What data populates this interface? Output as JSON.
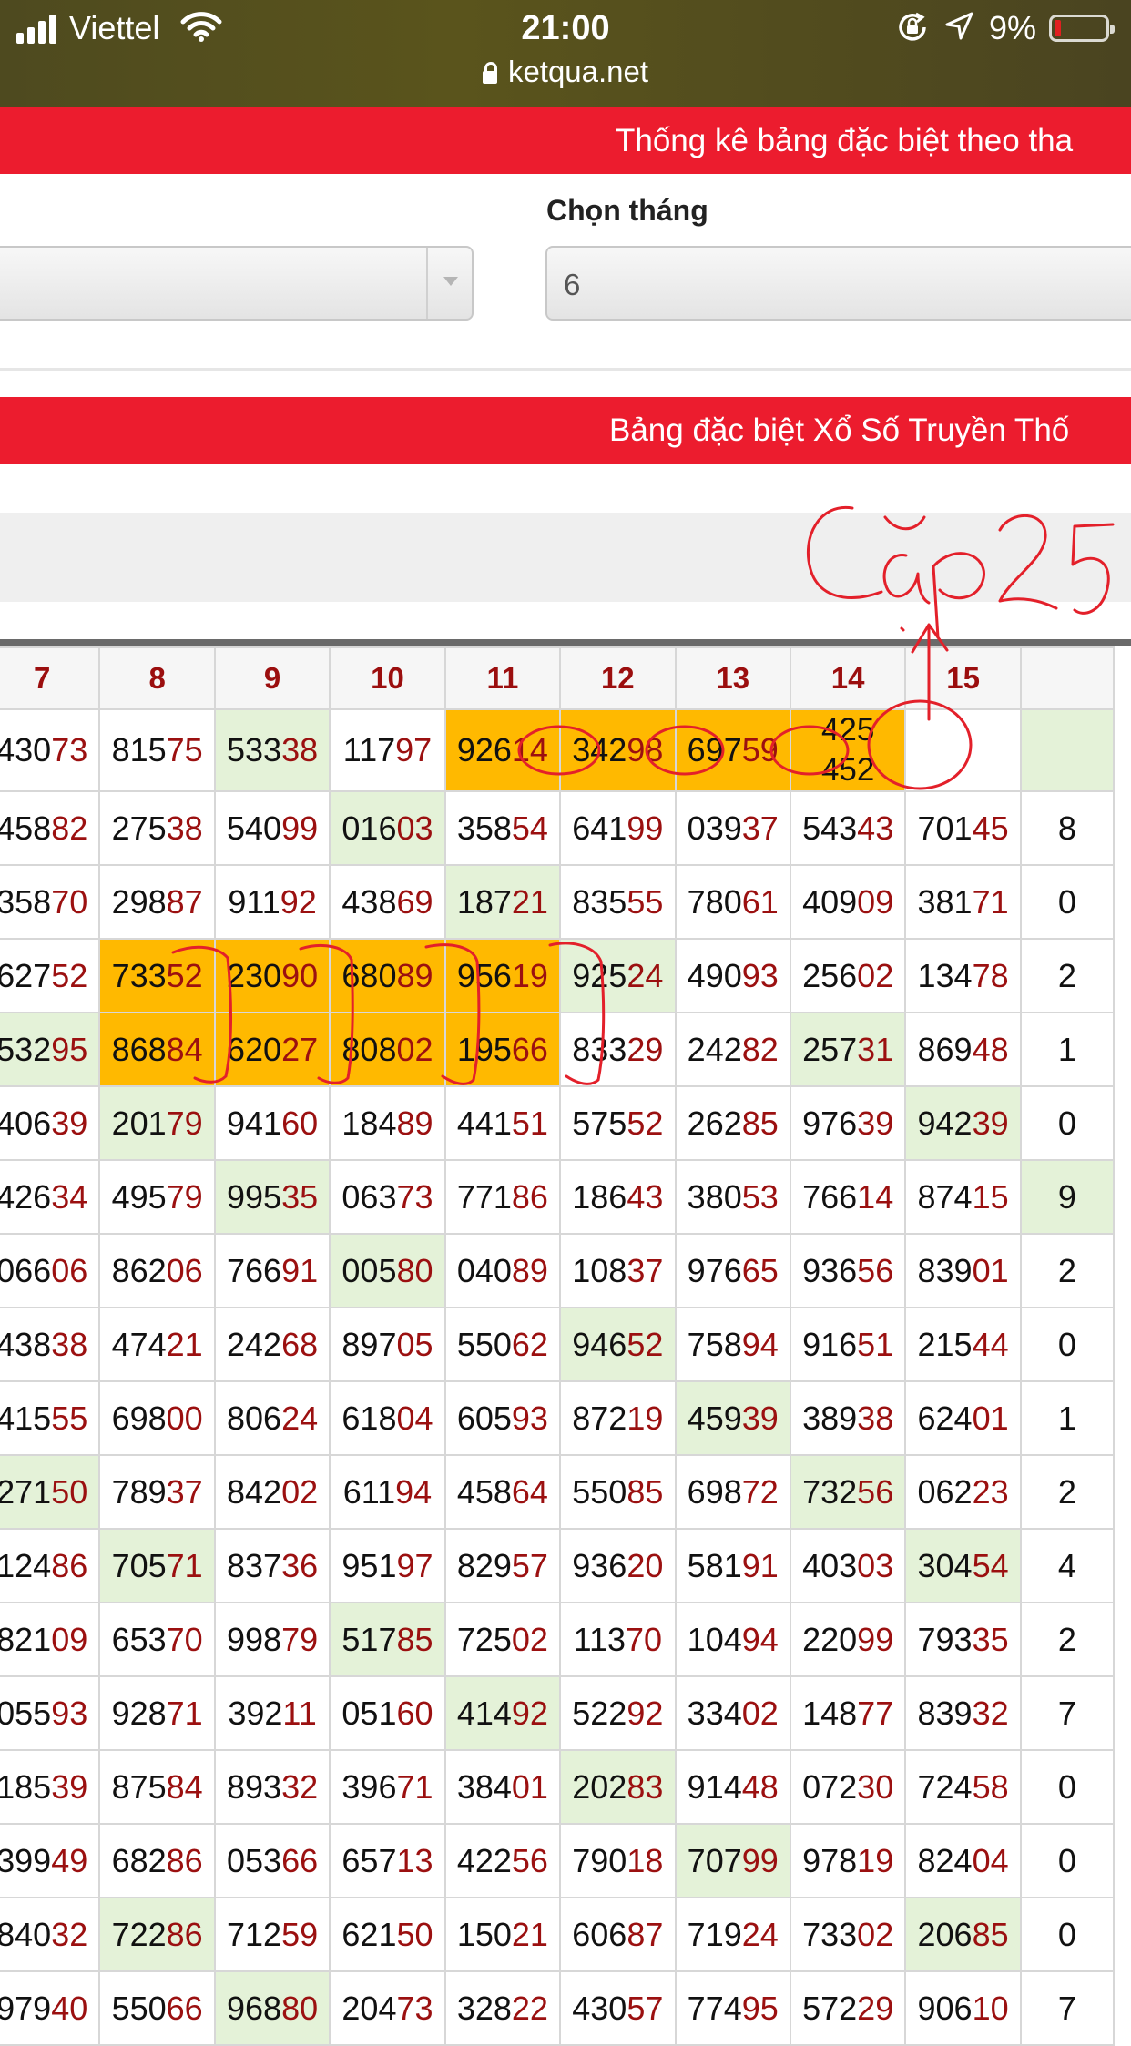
{
  "status_bar": {
    "carrier": "Viettel",
    "time": "21:00",
    "battery_percent": "9%",
    "url": "ketqua.net",
    "battery_level": 0.09
  },
  "banners": {
    "stats_title": "Thống kê bảng đặc biệt theo tha",
    "table_title": "Bảng đặc biệt Xổ Số Truyền Thố"
  },
  "month_select": {
    "label": "Chọn tháng",
    "value": "6"
  },
  "annotation": {
    "text": "Cặp25"
  },
  "colors": {
    "banner": "#ec1c2e",
    "header_text": "#9b0e0e",
    "highlight_orange": "#ffb900",
    "highlight_green": "#e4f2d8",
    "ink": "#e3202a"
  },
  "table": {
    "columns": [
      "7",
      "8",
      "9",
      "10",
      "11",
      "12",
      "13",
      "14",
      "15",
      ""
    ],
    "rows": [
      [
        {
          "t": "43073"
        },
        {
          "t": "81575"
        },
        {
          "t": "53338",
          "g": 1
        },
        {
          "t": "11797"
        },
        {
          "t": "92614",
          "o": 1
        },
        {
          "t": "34298",
          "o": 1
        },
        {
          "t": "69759",
          "o": 1
        },
        {
          "t": "425\n452",
          "o": 1
        },
        {
          "t": ""
        },
        {
          "t": "",
          "g": 1
        }
      ],
      [
        {
          "t": "45882"
        },
        {
          "t": "27538"
        },
        {
          "t": "54099"
        },
        {
          "t": "01603",
          "g": 1
        },
        {
          "t": "35854"
        },
        {
          "t": "64199"
        },
        {
          "t": "03937"
        },
        {
          "t": "54343"
        },
        {
          "t": "70145"
        },
        {
          "t": "8"
        }
      ],
      [
        {
          "t": "35870"
        },
        {
          "t": "29887"
        },
        {
          "t": "91192"
        },
        {
          "t": "43869"
        },
        {
          "t": "18721",
          "g": 1
        },
        {
          "t": "83555"
        },
        {
          "t": "78061"
        },
        {
          "t": "40909"
        },
        {
          "t": "38171"
        },
        {
          "t": "0"
        }
      ],
      [
        {
          "t": "62752"
        },
        {
          "t": "73352",
          "o": 1
        },
        {
          "t": "23090",
          "o": 1
        },
        {
          "t": "68089",
          "o": 1
        },
        {
          "t": "95619",
          "o": 1
        },
        {
          "t": "92524",
          "g": 1
        },
        {
          "t": "49093"
        },
        {
          "t": "25602"
        },
        {
          "t": "13478"
        },
        {
          "t": "2"
        }
      ],
      [
        {
          "t": "53295",
          "g": 1
        },
        {
          "t": "86884",
          "o": 1
        },
        {
          "t": "62027",
          "o": 1
        },
        {
          "t": "80802",
          "o": 1
        },
        {
          "t": "19566",
          "o": 1
        },
        {
          "t": "83329"
        },
        {
          "t": "24282"
        },
        {
          "t": "25731",
          "g": 1
        },
        {
          "t": "86948"
        },
        {
          "t": "1"
        }
      ],
      [
        {
          "t": "40639"
        },
        {
          "t": "20179",
          "g": 1
        },
        {
          "t": "94160"
        },
        {
          "t": "18489"
        },
        {
          "t": "44151"
        },
        {
          "t": "57552"
        },
        {
          "t": "26285"
        },
        {
          "t": "97639"
        },
        {
          "t": "94239",
          "g": 1
        },
        {
          "t": "0"
        }
      ],
      [
        {
          "t": "42634"
        },
        {
          "t": "49579"
        },
        {
          "t": "99535",
          "g": 1
        },
        {
          "t": "06373"
        },
        {
          "t": "77186"
        },
        {
          "t": "18643"
        },
        {
          "t": "38053"
        },
        {
          "t": "76614"
        },
        {
          "t": "87415"
        },
        {
          "t": "9",
          "g": 1
        }
      ],
      [
        {
          "t": "06606"
        },
        {
          "t": "86206"
        },
        {
          "t": "76691"
        },
        {
          "t": "00580",
          "g": 1
        },
        {
          "t": "04089"
        },
        {
          "t": "10837"
        },
        {
          "t": "97665"
        },
        {
          "t": "93656"
        },
        {
          "t": "83901"
        },
        {
          "t": "2"
        }
      ],
      [
        {
          "t": "43838"
        },
        {
          "t": "47421"
        },
        {
          "t": "24268"
        },
        {
          "t": "89705"
        },
        {
          "t": "55062"
        },
        {
          "t": "94652",
          "g": 1
        },
        {
          "t": "75894"
        },
        {
          "t": "91651"
        },
        {
          "t": "21544"
        },
        {
          "t": "0"
        }
      ],
      [
        {
          "t": "41555"
        },
        {
          "t": "69800"
        },
        {
          "t": "80624"
        },
        {
          "t": "61804"
        },
        {
          "t": "60593"
        },
        {
          "t": "87219"
        },
        {
          "t": "45939",
          "g": 1
        },
        {
          "t": "38938"
        },
        {
          "t": "62401"
        },
        {
          "t": "1"
        }
      ],
      [
        {
          "t": "27150",
          "g": 1
        },
        {
          "t": "78937"
        },
        {
          "t": "84202"
        },
        {
          "t": "61194"
        },
        {
          "t": "45864"
        },
        {
          "t": "55085"
        },
        {
          "t": "69872"
        },
        {
          "t": "73256",
          "g": 1
        },
        {
          "t": "06223"
        },
        {
          "t": "2"
        }
      ],
      [
        {
          "t": "12486"
        },
        {
          "t": "70571",
          "g": 1
        },
        {
          "t": "83736"
        },
        {
          "t": "95197"
        },
        {
          "t": "82957"
        },
        {
          "t": "93620"
        },
        {
          "t": "58191"
        },
        {
          "t": "40303"
        },
        {
          "t": "30454",
          "g": 1
        },
        {
          "t": "4"
        }
      ],
      [
        {
          "t": "82109"
        },
        {
          "t": "65370"
        },
        {
          "t": "99879"
        },
        {
          "t": "51785",
          "g": 1
        },
        {
          "t": "72502"
        },
        {
          "t": "11370"
        },
        {
          "t": "10494"
        },
        {
          "t": "22099"
        },
        {
          "t": "79335"
        },
        {
          "t": "2"
        }
      ],
      [
        {
          "t": "05593"
        },
        {
          "t": "92871"
        },
        {
          "t": "39211"
        },
        {
          "t": "05160"
        },
        {
          "t": "41492",
          "g": 1
        },
        {
          "t": "52292"
        },
        {
          "t": "33402"
        },
        {
          "t": "14877"
        },
        {
          "t": "83932"
        },
        {
          "t": "7"
        }
      ],
      [
        {
          "t": "18539"
        },
        {
          "t": "87584"
        },
        {
          "t": "89332"
        },
        {
          "t": "39671"
        },
        {
          "t": "38401"
        },
        {
          "t": "20283",
          "g": 1
        },
        {
          "t": "91448"
        },
        {
          "t": "07230"
        },
        {
          "t": "72458"
        },
        {
          "t": "0"
        }
      ],
      [
        {
          "t": "39949"
        },
        {
          "t": "68286"
        },
        {
          "t": "05366"
        },
        {
          "t": "65713"
        },
        {
          "t": "42256"
        },
        {
          "t": "79018"
        },
        {
          "t": "70799",
          "g": 1
        },
        {
          "t": "97819"
        },
        {
          "t": "82404"
        },
        {
          "t": "0"
        }
      ],
      [
        {
          "t": "84032"
        },
        {
          "t": "72286",
          "g": 1
        },
        {
          "t": "71259"
        },
        {
          "t": "62150"
        },
        {
          "t": "15021"
        },
        {
          "t": "60687"
        },
        {
          "t": "71924"
        },
        {
          "t": "73302"
        },
        {
          "t": "20685",
          "g": 1
        },
        {
          "t": "0"
        }
      ],
      [
        {
          "t": "97940"
        },
        {
          "t": "55066"
        },
        {
          "t": "96880",
          "g": 1
        },
        {
          "t": "20473"
        },
        {
          "t": "32822"
        },
        {
          "t": "43057"
        },
        {
          "t": "77495"
        },
        {
          "t": "57229"
        },
        {
          "t": "90610"
        },
        {
          "t": "7"
        }
      ]
    ]
  }
}
